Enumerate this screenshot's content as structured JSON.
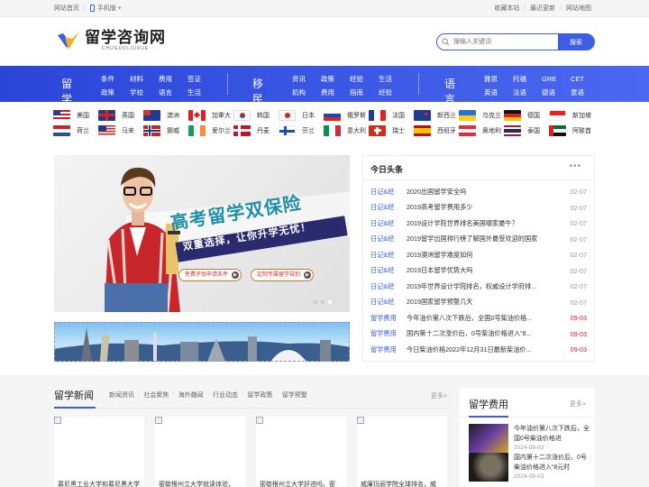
{
  "topbar": {
    "home": "网站首页",
    "mobile": "手机版",
    "mobile_arrow": "▾",
    "bookmark": "收藏本站",
    "recent": "最近更新",
    "sitemap": "网站地图"
  },
  "logo": {
    "cn": "留学咨询网",
    "en": "CHUGUOLIUXUE"
  },
  "search": {
    "placeholder": "搜输入关键词",
    "button": "搜索"
  },
  "nav": {
    "groups": [
      {
        "title": "留学",
        "items": [
          "条件",
          "政策",
          "材料",
          "学校",
          "费用",
          "语言",
          "签证",
          "生活"
        ]
      },
      {
        "title": "移民",
        "items": [
          "资讯",
          "机构",
          "政策",
          "费用",
          "经验",
          "指南",
          "生活",
          "经验"
        ]
      },
      {
        "title": "语言",
        "items": [
          "雅思",
          "英语",
          "托福",
          "法语",
          "GRE",
          "德语",
          "CET",
          "意语"
        ]
      }
    ]
  },
  "countries": [
    "美国",
    "英国",
    "澳洲",
    "加拿大",
    "韩国",
    "日本",
    "俄罗斯",
    "法国",
    "新西兰",
    "乌克兰",
    "德国",
    "新加坡",
    "荷兰",
    "马来",
    "挪威",
    "爱尔兰",
    "丹麦",
    "芬兰",
    "意大利",
    "瑞士",
    "西班牙",
    "奥地利",
    "泰国",
    "阿联酋"
  ],
  "hero": {
    "title": "高考留学双保险",
    "subtitle": "双重选择，让你升学无忧！",
    "btn1": "免费评估申请条件",
    "btn2": "定制专属留学规划",
    "btn_icon": "▶"
  },
  "news": {
    "title": "今日头条",
    "more": "•••",
    "items": [
      {
        "cat": "日记&经",
        "title": "2020出国留学安全吗",
        "date": "02-07",
        "hot": false
      },
      {
        "cat": "日记&经",
        "title": "2019高考留学费用多少",
        "date": "02-07",
        "hot": false
      },
      {
        "cat": "日记&经",
        "title": "2019设计学院世界排名美国哪家最牛？",
        "date": "02-07",
        "hot": false
      },
      {
        "cat": "日记&经",
        "title": "2019留学出国排行榜了解国外最受欢迎的国家",
        "date": "02-07",
        "hot": false
      },
      {
        "cat": "日记&经",
        "title": "2019澳洲留学难度如何",
        "date": "02-07",
        "hot": false
      },
      {
        "cat": "日记&经",
        "title": "2019日本留学优势大吗",
        "date": "02-07",
        "hot": false
      },
      {
        "cat": "日记&经",
        "title": "2019年世界设计学院排名，权威设计学府排...",
        "date": "02-07",
        "hot": false
      },
      {
        "cat": "日记&经",
        "title": "2019国家留学预警几天",
        "date": "02-07",
        "hot": false
      },
      {
        "cat": "留学费用",
        "title": "今年油价第八次下跌后，全国0号柴油价格...",
        "date": "09-03",
        "hot": true
      },
      {
        "cat": "留学费用",
        "title": "国内第十二次涨价后，0号柴油价格进入“8...",
        "date": "09-03",
        "hot": true
      },
      {
        "cat": "留学费用",
        "title": "今日柴油价格2022年12月31日最新柴油价...",
        "date": "09-03",
        "hot": true
      }
    ]
  },
  "study_news": {
    "title": "留学新闻",
    "tabs": [
      "新闻资讯",
      "社会聚焦",
      "海外趣闻",
      "行业动态",
      "留学政策",
      "留学预警"
    ],
    "tab_sep": "·",
    "more": "更多>",
    "cards": [
      "慕尼黑工业大学和慕尼黑大学",
      "密歇根州立大学就读体验，",
      "密歇根州立大学好进吗，密",
      "威廉玛丽学院全球排名，威"
    ]
  },
  "fees": {
    "title": "留学费用",
    "more": "更多>",
    "items": [
      {
        "title": "今年油价第八次下跌后，全国0号柴油价格进",
        "date": "2024-09-03"
      },
      {
        "title": "国内第十二次涨价后，0号柴油价格进入“8元时",
        "date": "2024-09-03"
      }
    ]
  },
  "colors": {
    "accent": "#3b5de7",
    "hot": "#e21f1f"
  }
}
